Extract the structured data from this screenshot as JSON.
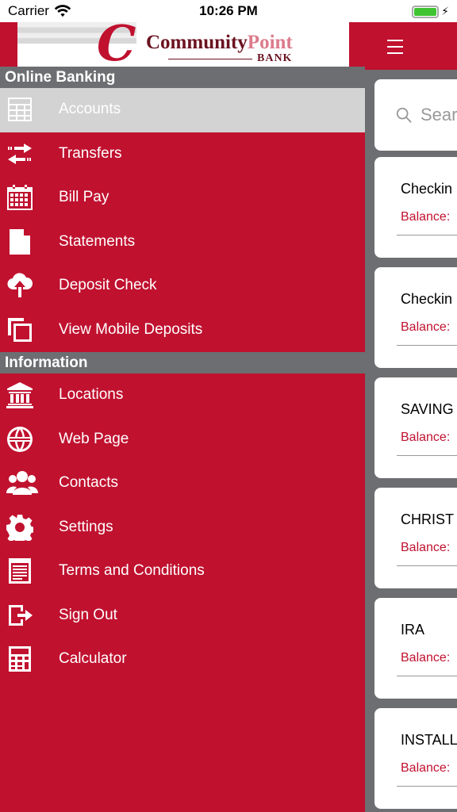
{
  "status_bar": {
    "carrier": "Carrier",
    "time": "10:26 PM"
  },
  "logo": {
    "letter": "C",
    "name_part1": "Community",
    "name_part2": "Point",
    "bank": "BANK"
  },
  "sections": [
    {
      "title": "Online Banking",
      "items": [
        {
          "label": "Accounts",
          "icon": "table-icon"
        },
        {
          "label": "Transfers",
          "icon": "transfer-arrows-icon"
        },
        {
          "label": "Bill Pay",
          "icon": "calendar-icon"
        },
        {
          "label": "Statements",
          "icon": "document-icon"
        },
        {
          "label": "Deposit Check",
          "icon": "cloud-upload-icon"
        },
        {
          "label": "View Mobile Deposits",
          "icon": "copy-icon"
        }
      ]
    },
    {
      "title": "Information",
      "items": [
        {
          "label": "Locations",
          "icon": "bank-building-icon"
        },
        {
          "label": "Web Page",
          "icon": "globe-icon"
        },
        {
          "label": "Contacts",
          "icon": "people-icon"
        },
        {
          "label": "Settings",
          "icon": "gear-icon"
        },
        {
          "label": "Terms and Conditions",
          "icon": "notepad-icon"
        },
        {
          "label": "Sign Out",
          "icon": "sign-out-icon"
        },
        {
          "label": "Calculator",
          "icon": "calculator-icon"
        }
      ]
    }
  ],
  "search": {
    "placeholder": "Sear"
  },
  "accounts": [
    {
      "name": "Checkin",
      "balance_label": "Balance:"
    },
    {
      "name": "Checkin",
      "balance_label": "Balance:"
    },
    {
      "name": "SAVING",
      "balance_label": "Balance:"
    },
    {
      "name": "CHRIST",
      "balance_label": "Balance:"
    },
    {
      "name": "IRA",
      "balance_label": "Balance:"
    },
    {
      "name": "INSTALL",
      "balance_label": "Balance:"
    }
  ],
  "colors": {
    "brand_red": "#c0112f",
    "header_grey": "#6d6e71",
    "active_row": "#d3d3d3"
  }
}
